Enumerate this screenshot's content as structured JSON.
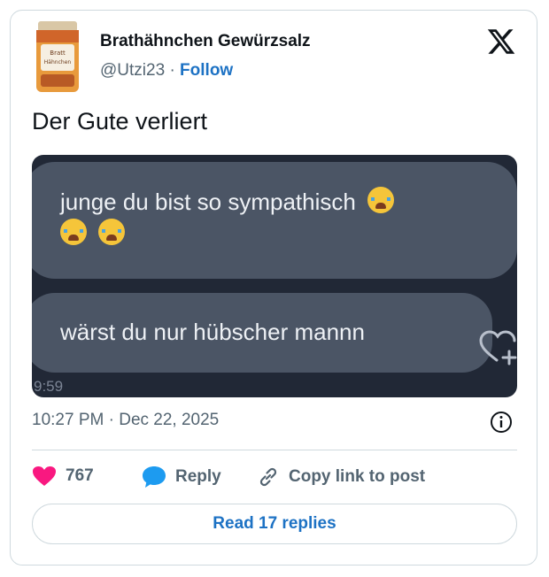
{
  "author": {
    "name": "Brathähnchen Gewürzsalz",
    "handle": "@Utzi23",
    "separator": "·",
    "follow_label": "Follow",
    "avatar_label_top": "Bratt",
    "avatar_label_bottom": "Hähnchen"
  },
  "tweet": {
    "text": "Der Gute verliert",
    "time": "10:27 PM",
    "separator": "·",
    "date": "Dec 22, 2025"
  },
  "media": {
    "message1": "junge du bist so sympathisch",
    "message2": "wärst du nur hübscher mannn",
    "clock_text": "9:59"
  },
  "actions": {
    "like_count": "767",
    "reply_label": "Reply",
    "copy_label": "Copy link to post"
  },
  "footer": {
    "read_replies_label": "Read 17 replies"
  },
  "colors": {
    "like": "#f91880",
    "reply": "#1d9bf0",
    "link": "#1d72c4",
    "media_bg": "#212836",
    "bubble": "#4b5565"
  },
  "icons": [
    "x-logo-icon",
    "crying-emoji-icon",
    "heart-plus-icon",
    "info-icon",
    "heart-icon",
    "reply-bubble-icon",
    "link-icon"
  ]
}
